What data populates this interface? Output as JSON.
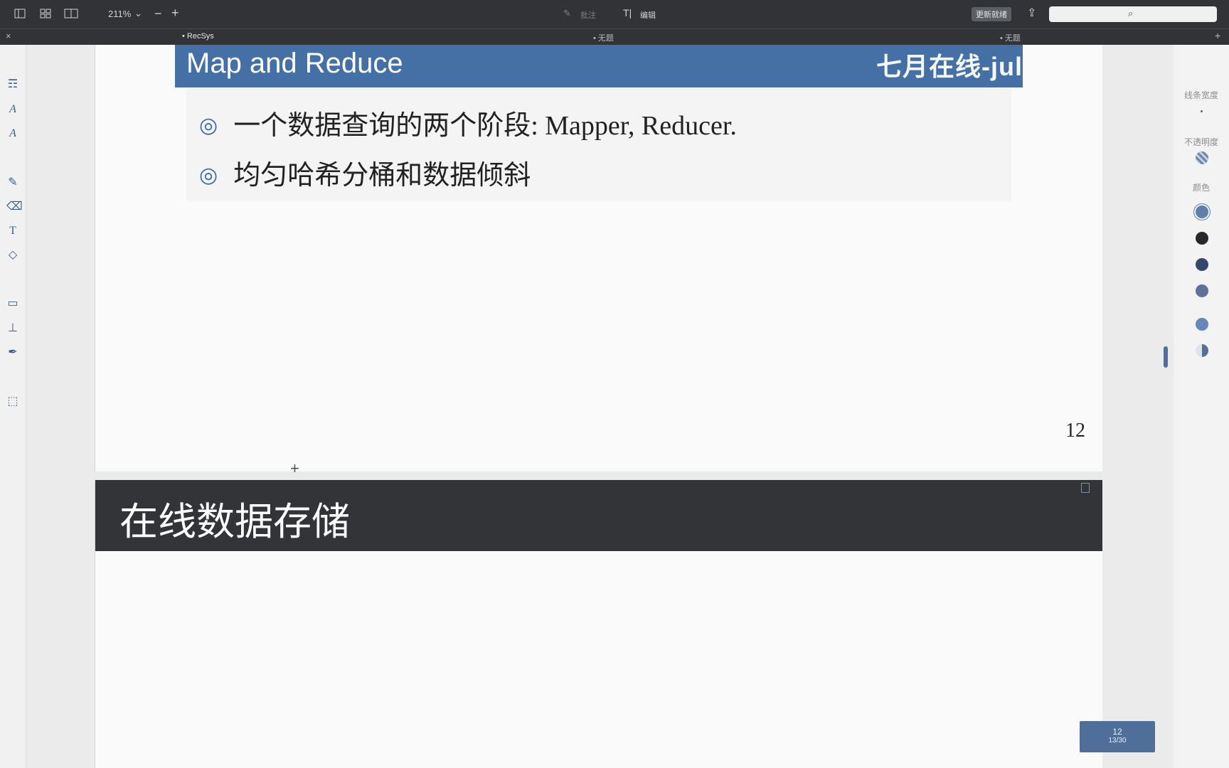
{
  "toolbar": {
    "zoom": "211%",
    "annotate_label": "批注",
    "edit_label": "编辑",
    "update_label": "更新就绪"
  },
  "tabs": [
    {
      "label": "• RecSys"
    },
    {
      "label": "• 无题"
    },
    {
      "label": "• 无题"
    }
  ],
  "right_panel": {
    "line_width_label": "线条宽度",
    "opacity_label": "不透明度",
    "color_label": "颜色"
  },
  "slide1": {
    "title": "Map and Reduce",
    "watermark": "七月在线-jul",
    "bullets": [
      "一个数据查询的两个阶段: Mapper, Reducer.",
      "均匀哈希分桶和数据倾斜"
    ],
    "bullet_marker": "◎",
    "page_number": "12"
  },
  "slide2": {
    "title": "在线数据存储"
  },
  "page_indicator": {
    "current": "12",
    "of_total": "13/30"
  },
  "colors": {
    "accent": "#4470a6",
    "toolbar": "#323336",
    "slide2_header": "#333437"
  }
}
